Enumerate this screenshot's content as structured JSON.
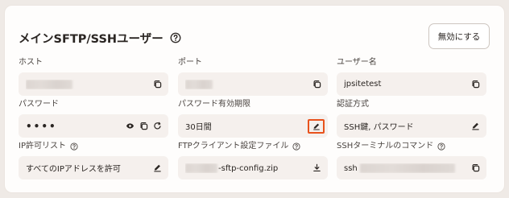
{
  "header": {
    "title": "メインSFTP/SSHユーザー",
    "disable_button": "無効にする"
  },
  "fields": {
    "host": {
      "label": "ホスト",
      "value": ""
    },
    "port": {
      "label": "ポート",
      "value": ""
    },
    "username": {
      "label": "ユーザー名",
      "value": "jpsitetest"
    },
    "password": {
      "label": "パスワード",
      "value": "••••"
    },
    "password_expiry": {
      "label": "パスワード有効期限",
      "value": "30日間"
    },
    "auth_method": {
      "label": "認証方式",
      "value": "SSH鍵, パスワード"
    },
    "ip_allow": {
      "label": "IP許可リスト",
      "value": "すべてのIPアドレスを許可"
    },
    "ftp_config": {
      "label": "FTPクライアント設定ファイル",
      "value": "-sftp-config.zip"
    },
    "ssh_command": {
      "label": "SSHターミナルのコマンド",
      "value": "ssh"
    }
  },
  "colors": {
    "highlight": "#e8521c",
    "field_bg": "#f5f0ed",
    "page_bg": "#efeae6"
  }
}
